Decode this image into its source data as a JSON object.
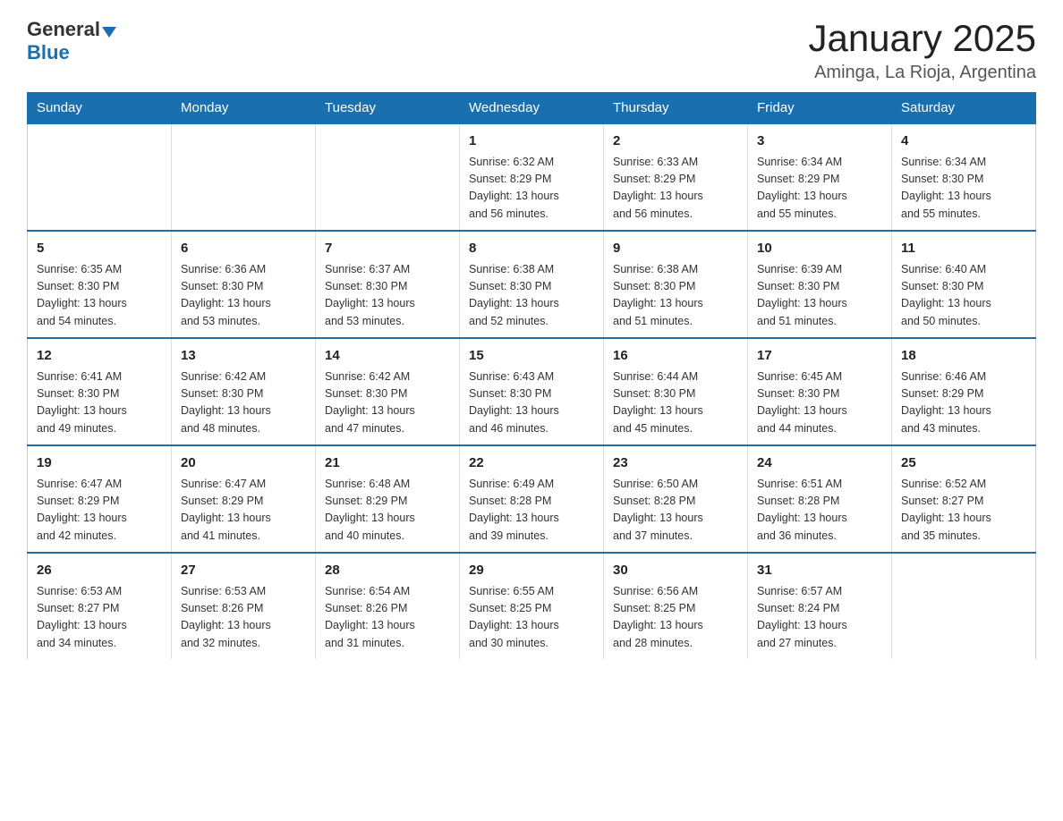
{
  "logo": {
    "text_general": "General",
    "text_blue": "Blue",
    "arrow_color": "#1a6faf"
  },
  "header": {
    "title": "January 2025",
    "subtitle": "Aminga, La Rioja, Argentina"
  },
  "calendar": {
    "days_of_week": [
      "Sunday",
      "Monday",
      "Tuesday",
      "Wednesday",
      "Thursday",
      "Friday",
      "Saturday"
    ],
    "weeks": [
      [
        {
          "day": "",
          "info": ""
        },
        {
          "day": "",
          "info": ""
        },
        {
          "day": "",
          "info": ""
        },
        {
          "day": "1",
          "info": "Sunrise: 6:32 AM\nSunset: 8:29 PM\nDaylight: 13 hours\nand 56 minutes."
        },
        {
          "day": "2",
          "info": "Sunrise: 6:33 AM\nSunset: 8:29 PM\nDaylight: 13 hours\nand 56 minutes."
        },
        {
          "day": "3",
          "info": "Sunrise: 6:34 AM\nSunset: 8:29 PM\nDaylight: 13 hours\nand 55 minutes."
        },
        {
          "day": "4",
          "info": "Sunrise: 6:34 AM\nSunset: 8:30 PM\nDaylight: 13 hours\nand 55 minutes."
        }
      ],
      [
        {
          "day": "5",
          "info": "Sunrise: 6:35 AM\nSunset: 8:30 PM\nDaylight: 13 hours\nand 54 minutes."
        },
        {
          "day": "6",
          "info": "Sunrise: 6:36 AM\nSunset: 8:30 PM\nDaylight: 13 hours\nand 53 minutes."
        },
        {
          "day": "7",
          "info": "Sunrise: 6:37 AM\nSunset: 8:30 PM\nDaylight: 13 hours\nand 53 minutes."
        },
        {
          "day": "8",
          "info": "Sunrise: 6:38 AM\nSunset: 8:30 PM\nDaylight: 13 hours\nand 52 minutes."
        },
        {
          "day": "9",
          "info": "Sunrise: 6:38 AM\nSunset: 8:30 PM\nDaylight: 13 hours\nand 51 minutes."
        },
        {
          "day": "10",
          "info": "Sunrise: 6:39 AM\nSunset: 8:30 PM\nDaylight: 13 hours\nand 51 minutes."
        },
        {
          "day": "11",
          "info": "Sunrise: 6:40 AM\nSunset: 8:30 PM\nDaylight: 13 hours\nand 50 minutes."
        }
      ],
      [
        {
          "day": "12",
          "info": "Sunrise: 6:41 AM\nSunset: 8:30 PM\nDaylight: 13 hours\nand 49 minutes."
        },
        {
          "day": "13",
          "info": "Sunrise: 6:42 AM\nSunset: 8:30 PM\nDaylight: 13 hours\nand 48 minutes."
        },
        {
          "day": "14",
          "info": "Sunrise: 6:42 AM\nSunset: 8:30 PM\nDaylight: 13 hours\nand 47 minutes."
        },
        {
          "day": "15",
          "info": "Sunrise: 6:43 AM\nSunset: 8:30 PM\nDaylight: 13 hours\nand 46 minutes."
        },
        {
          "day": "16",
          "info": "Sunrise: 6:44 AM\nSunset: 8:30 PM\nDaylight: 13 hours\nand 45 minutes."
        },
        {
          "day": "17",
          "info": "Sunrise: 6:45 AM\nSunset: 8:30 PM\nDaylight: 13 hours\nand 44 minutes."
        },
        {
          "day": "18",
          "info": "Sunrise: 6:46 AM\nSunset: 8:29 PM\nDaylight: 13 hours\nand 43 minutes."
        }
      ],
      [
        {
          "day": "19",
          "info": "Sunrise: 6:47 AM\nSunset: 8:29 PM\nDaylight: 13 hours\nand 42 minutes."
        },
        {
          "day": "20",
          "info": "Sunrise: 6:47 AM\nSunset: 8:29 PM\nDaylight: 13 hours\nand 41 minutes."
        },
        {
          "day": "21",
          "info": "Sunrise: 6:48 AM\nSunset: 8:29 PM\nDaylight: 13 hours\nand 40 minutes."
        },
        {
          "day": "22",
          "info": "Sunrise: 6:49 AM\nSunset: 8:28 PM\nDaylight: 13 hours\nand 39 minutes."
        },
        {
          "day": "23",
          "info": "Sunrise: 6:50 AM\nSunset: 8:28 PM\nDaylight: 13 hours\nand 37 minutes."
        },
        {
          "day": "24",
          "info": "Sunrise: 6:51 AM\nSunset: 8:28 PM\nDaylight: 13 hours\nand 36 minutes."
        },
        {
          "day": "25",
          "info": "Sunrise: 6:52 AM\nSunset: 8:27 PM\nDaylight: 13 hours\nand 35 minutes."
        }
      ],
      [
        {
          "day": "26",
          "info": "Sunrise: 6:53 AM\nSunset: 8:27 PM\nDaylight: 13 hours\nand 34 minutes."
        },
        {
          "day": "27",
          "info": "Sunrise: 6:53 AM\nSunset: 8:26 PM\nDaylight: 13 hours\nand 32 minutes."
        },
        {
          "day": "28",
          "info": "Sunrise: 6:54 AM\nSunset: 8:26 PM\nDaylight: 13 hours\nand 31 minutes."
        },
        {
          "day": "29",
          "info": "Sunrise: 6:55 AM\nSunset: 8:25 PM\nDaylight: 13 hours\nand 30 minutes."
        },
        {
          "day": "30",
          "info": "Sunrise: 6:56 AM\nSunset: 8:25 PM\nDaylight: 13 hours\nand 28 minutes."
        },
        {
          "day": "31",
          "info": "Sunrise: 6:57 AM\nSunset: 8:24 PM\nDaylight: 13 hours\nand 27 minutes."
        },
        {
          "day": "",
          "info": ""
        }
      ]
    ]
  }
}
